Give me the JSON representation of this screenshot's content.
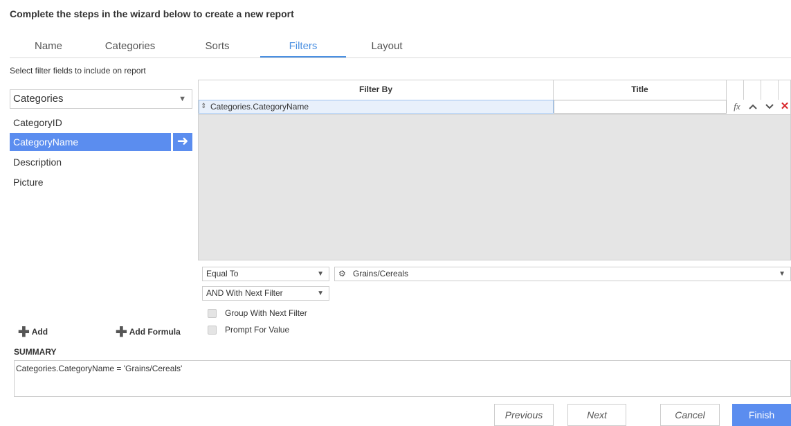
{
  "wizard": {
    "title": "Complete the steps in the wizard below to create a new report"
  },
  "tabs": [
    {
      "label": "Name"
    },
    {
      "label": "Categories"
    },
    {
      "label": "Sorts"
    },
    {
      "label": "Filters",
      "active": true
    },
    {
      "label": "Layout"
    }
  ],
  "fields_panel": {
    "hint": "Select filter fields to include on report",
    "table_select": "Categories",
    "fields": [
      "CategoryID",
      "CategoryName",
      "Description",
      "Picture"
    ],
    "selected_field": "CategoryName"
  },
  "grid": {
    "headers": {
      "filter_by": "Filter By",
      "title": "Title"
    },
    "rows": [
      {
        "filter_by": "Categories.CategoryName",
        "title": ""
      }
    ],
    "row_icons": {
      "formula": "fx",
      "up": "chevron-up-icon",
      "down": "chevron-down-icon",
      "delete": "close-icon"
    }
  },
  "filter_settings": {
    "operator": "Equal To",
    "value": "Grains/Cereals",
    "conjunction": "AND With Next Filter",
    "group_with_next": {
      "label": "Group With Next Filter",
      "checked": false
    },
    "prompt_for_value": {
      "label": "Prompt For Value",
      "checked": false
    }
  },
  "actions": {
    "add": "Add",
    "add_formula": "Add Formula"
  },
  "summary": {
    "label": "SUMMARY",
    "text": "Categories.CategoryName = 'Grains/Cereals'"
  },
  "nav_buttons": {
    "previous": "Previous",
    "next": "Next",
    "cancel": "Cancel",
    "finish": "Finish"
  },
  "colors": {
    "accent": "#5b8def",
    "tab_active": "#4a90e2",
    "delete": "#d9262b"
  }
}
